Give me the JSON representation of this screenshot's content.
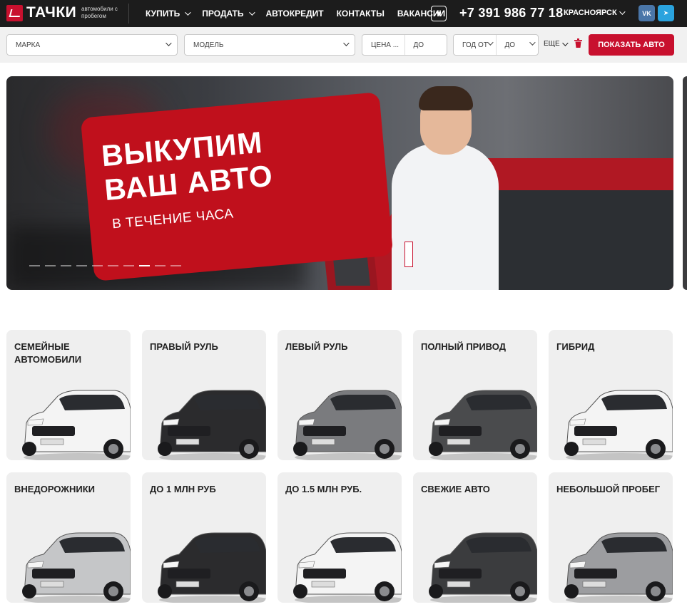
{
  "header": {
    "logo_text": "ТАЧКИ",
    "logo_sub": "автомобили с пробегом",
    "nav": [
      {
        "label": "КУПИТЬ",
        "dropdown": true
      },
      {
        "label": "ПРОДАТЬ",
        "dropdown": true
      },
      {
        "label": "АВТОКРЕДИТ",
        "dropdown": false
      },
      {
        "label": "КОНТАКТЫ",
        "dropdown": false
      },
      {
        "label": "ВАКАНСИИ",
        "dropdown": false
      }
    ],
    "favorites_icon": "heart-icon",
    "phone": "+7 391 986 77 18",
    "city": "КРАСНОЯРСК",
    "social": [
      {
        "name": "vk-icon",
        "label": "VK",
        "color": "#4a76a8"
      },
      {
        "name": "telegram-icon",
        "label": "➤",
        "color": "#2aa3de"
      }
    ],
    "background": "#1c1c1c"
  },
  "filters": {
    "brand_placeholder": "МАРКА",
    "model_placeholder": "МОДЕЛЬ",
    "price_from_placeholder": "ЦЕНА ...",
    "price_to_placeholder": "ДО",
    "year_from_placeholder": "ГОД ОТ",
    "year_to_placeholder": "ДО",
    "more_label": "ЕЩЕ",
    "reset_icon": "trash-icon",
    "submit_label": "ПОКАЗАТЬ АВТО",
    "accent": "#c8102e"
  },
  "hero": {
    "headline_line1": "ВЫКУПИМ",
    "headline_line2": "ВАШ АВТО",
    "subline": "В ТЕЧЕНИЕ ЧАСА",
    "slides_total": 10,
    "active_slide": 8
  },
  "categories": [
    {
      "label": "СЕМЕЙНЫЕ АВТОМОБИЛИ",
      "car_color": "#f4f4f4"
    },
    {
      "label": "ПРАВЫЙ РУЛЬ",
      "car_color": "#2b2b2d"
    },
    {
      "label": "ЛЕВЫЙ РУЛЬ",
      "car_color": "#7a7b7e"
    },
    {
      "label": "ПОЛНЫЙ ПРИВОД",
      "car_color": "#4a4b4d"
    },
    {
      "label": "ГИБРИД",
      "car_color": "#f4f4f4"
    },
    {
      "label": "ВНЕДОРОЖНИКИ",
      "car_color": "#c5c6c8"
    },
    {
      "label": "ДО 1 МЛН РУБ",
      "car_color": "#2b2b2d"
    },
    {
      "label": "ДО 1.5 МЛН РУБ.",
      "car_color": "#f4f4f4"
    },
    {
      "label": "СВЕЖИЕ АВТО",
      "car_color": "#3b3c3e"
    },
    {
      "label": "НЕБОЛЬШОЙ ПРОБЕГ",
      "car_color": "#9c9da0"
    }
  ]
}
